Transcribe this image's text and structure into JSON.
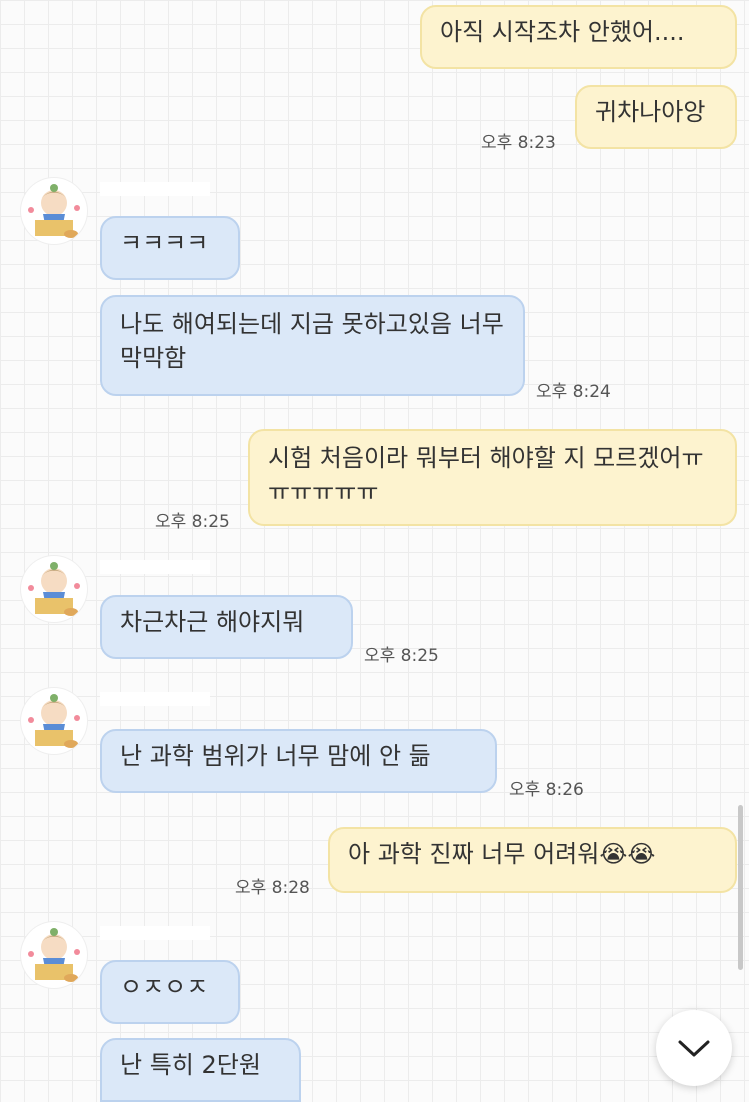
{
  "messages": [
    {
      "text": "아직 시작조차 안했어....",
      "time": ""
    },
    {
      "text": "귀차나아앙",
      "time": "오후 8:23"
    },
    {
      "text": "ㅋㅋㅋㅋ",
      "time": ""
    },
    {
      "text": "나도 해여되는데 지금 못하고있음 너무 막막함",
      "time": "오후 8:24"
    },
    {
      "text": "시험 처음이라 뭐부터 해야할 지 모르겠어ㅠㅠㅠㅠㅠㅠ",
      "time": "오후 8:25"
    },
    {
      "text": "차근차근 해야지뭐",
      "time": "오후 8:25"
    },
    {
      "text": "난 과학 범위가 너무 맘에 안 듦",
      "time": "오후 8:26"
    },
    {
      "text": "아 과학 진짜 너무 어려워😭😭",
      "time": "오후 8:28"
    },
    {
      "text": "ㅇㅈㅇㅈ",
      "time": ""
    },
    {
      "text": "난 특히 2단원",
      "time": ""
    }
  ],
  "icons": {
    "avatar": "avatar-character-icon",
    "scroll": "chevron-down-icon"
  },
  "colors": {
    "mine_bubble": "#fdf3cf",
    "theirs_bubble": "#dbe8f8"
  }
}
